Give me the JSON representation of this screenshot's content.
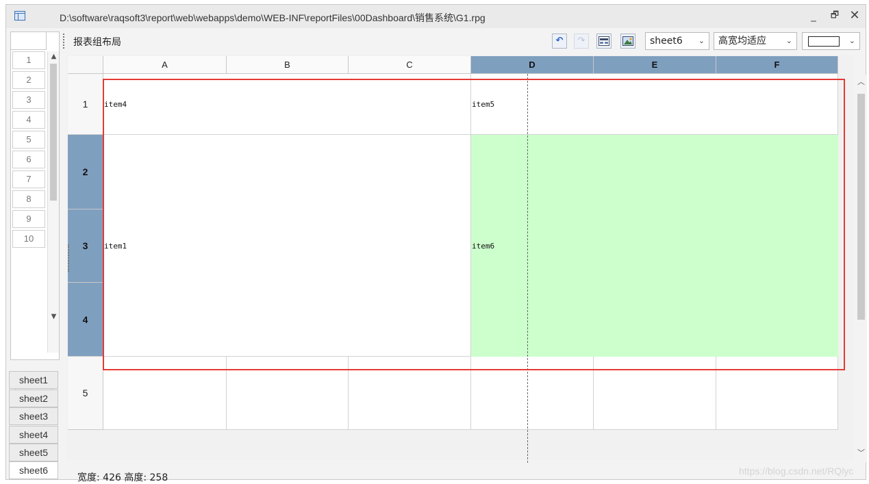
{
  "window": {
    "title": "D:\\software\\raqsoft3\\report\\web\\webapps\\demo\\WEB-INF\\reportFiles\\00Dashboard\\销售系统\\G1.rpg",
    "min_label": "_",
    "max_label": "🗗",
    "close_label": "✕"
  },
  "toolbar": {
    "layout_label": "报表组布局",
    "sheet_select": "sheet6",
    "fit_select": "高宽均适应"
  },
  "left_panel": {
    "rows": [
      "1",
      "2",
      "3",
      "4",
      "5",
      "6",
      "7",
      "8",
      "9",
      "10"
    ]
  },
  "sheet_tabs": [
    "sheet1",
    "sheet2",
    "sheet3",
    "sheet4",
    "sheet5",
    "sheet6"
  ],
  "active_sheet": "sheet6",
  "grid": {
    "columns": [
      "A",
      "B",
      "C",
      "D",
      "E",
      "F"
    ],
    "selected_columns": [
      "D",
      "E",
      "F"
    ],
    "rows": [
      "1",
      "2",
      "3",
      "4",
      "5"
    ],
    "selected_rows": [
      "2",
      "3",
      "4"
    ],
    "cells": {
      "A1": "item4",
      "D1": "item5",
      "A2": "item1",
      "D2": "item6"
    }
  },
  "status": {
    "text": "宽度: 426 高度: 258"
  },
  "watermark": "https://blog.csdn.net/RQlyc",
  "colors": {
    "selected_header": "#7f9fbf",
    "green_fill": "#ccffcc",
    "selection_border": "#e53935"
  }
}
